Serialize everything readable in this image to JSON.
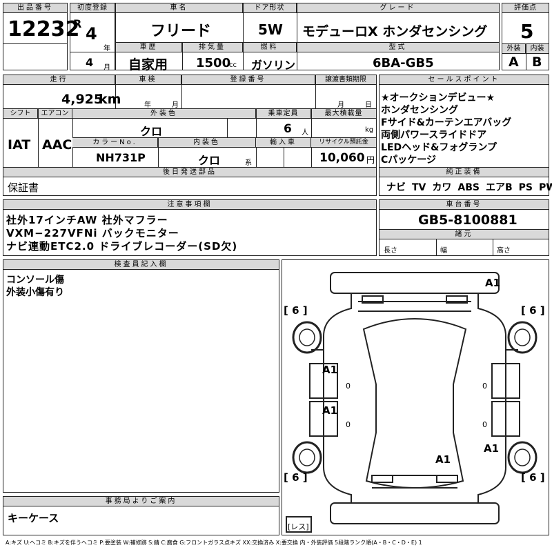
{
  "lot": {
    "header": "出品番号",
    "value": "12232"
  },
  "first_reg": {
    "header": "初度登録",
    "era": "R",
    "year": "4",
    "year_unit": "年",
    "month": "4",
    "month_unit": "月"
  },
  "car_name": {
    "header": "車名",
    "value": "フリード"
  },
  "door": {
    "header": "ドア形状",
    "value": "5W"
  },
  "grade": {
    "header": "グレード",
    "value": "モデューロX ホンダセンシング"
  },
  "score": {
    "header": "評価点",
    "value": "5"
  },
  "history": {
    "header": "車歴",
    "value": "自家用"
  },
  "displacement": {
    "header": "排気量",
    "value": "1500",
    "unit": "cc"
  },
  "fuel": {
    "header": "燃料",
    "value": "ガソリン"
  },
  "model_code": {
    "header": "型式",
    "value": "6BA-GB5"
  },
  "exterior_grade": {
    "header": "外装",
    "value": "A"
  },
  "interior_grade": {
    "header": "内装",
    "value": "B"
  },
  "mileage": {
    "header": "走行",
    "value": "4,925",
    "unit": "km"
  },
  "shaken": {
    "header": "車検",
    "year_unit": "年",
    "month_unit": "月"
  },
  "reg_no": {
    "header": "登録番号"
  },
  "transfer_deadline": {
    "header": "譲渡書類期限",
    "month_unit": "月",
    "day_unit": "日"
  },
  "shift": {
    "header": "シフト",
    "value": "IAT"
  },
  "aircon": {
    "header": "エアコン",
    "value": "AAC"
  },
  "ext_color": {
    "header": "外装色",
    "value": "クロ"
  },
  "capacity": {
    "header": "乗車定員",
    "value": "6",
    "unit": "人"
  },
  "max_load": {
    "header": "最大積載量",
    "unit": "kg"
  },
  "color_no": {
    "header": "カラーNo.",
    "value": "NH731P"
  },
  "int_color": {
    "header": "内装色",
    "value": "クロ",
    "unit": "系"
  },
  "import": {
    "header": "輸入車"
  },
  "recycle": {
    "header": "リサイクル預託金",
    "value": "10,060",
    "unit": "円"
  },
  "selling_points": {
    "header": "セールスポイント",
    "lines": [
      "★オークションデビュー★",
      "ホンダセンシング",
      "Fサイド&カーテンエアバッグ",
      "両側パワースライドドア",
      "LEDヘッド&フォグランプ",
      "Cパッケージ"
    ]
  },
  "later_parts": {
    "header": "後日発送部品",
    "value": "保証書"
  },
  "equipment": {
    "header": "純正装備",
    "items": [
      "ナビ",
      "TV",
      "カワ",
      "ABS",
      "エアB",
      "PS",
      "PW"
    ]
  },
  "notes": {
    "header": "注意事項欄",
    "lines": [
      "社外17インチAW 社外マフラー",
      "VXM−227VFNi バックモニター",
      "ナビ連動ETC2.0 ドライブレコーダー(SD欠)"
    ]
  },
  "chassis": {
    "header": "車台番号",
    "value": "GB5-8100881"
  },
  "specs": {
    "header": "諸元",
    "length": "長さ",
    "width": "幅",
    "height": "高さ"
  },
  "inspector": {
    "header": "検査員記入欄",
    "lines": [
      "コンソール傷",
      "外装小傷有り"
    ]
  },
  "office": {
    "header": "事務局よりご案内",
    "value": "キーケース"
  },
  "diagram": {
    "tires": [
      "[ 6 ]",
      "[ 6 ]",
      "[ 6 ]",
      "[ 6 ]"
    ],
    "marks": [
      "A1",
      "A1",
      "A1",
      "A1",
      "A1"
    ],
    "zeros": [
      "0",
      "0",
      "0",
      "0"
    ],
    "spare": "[レス]"
  },
  "legend": "A:キズ U:ヘコミ B:キズを伴うヘコミ P:要塗装 W:補修跡 S:錆 C:腐食 G:フロントガラス点キズ XX:交換済み X:要交換 内・外装評価 5段階ランク順(A・B・C・D・E) 1"
}
